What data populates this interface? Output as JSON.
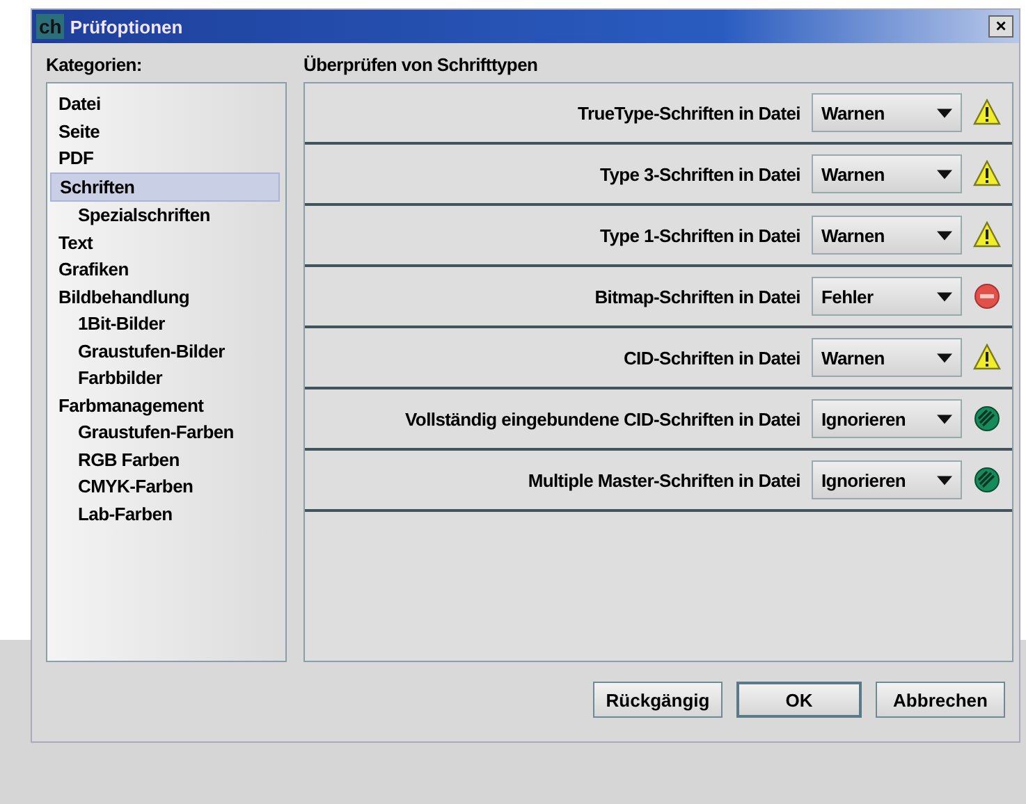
{
  "window": {
    "title": "Prüfoptionen",
    "logo": "ch",
    "close": "×"
  },
  "sidebar": {
    "heading": "Kategorien:",
    "items": [
      {
        "label": "Datei",
        "selected": false
      },
      {
        "label": "Seite",
        "selected": false
      },
      {
        "label": "PDF",
        "selected": false
      },
      {
        "label": "Schriften",
        "selected": true,
        "children": [
          {
            "label": "Spezialschriften",
            "selected": false
          }
        ]
      },
      {
        "label": "Text",
        "selected": false
      },
      {
        "label": "Grafiken",
        "selected": false
      },
      {
        "label": "Bildbehandlung",
        "selected": false,
        "children": [
          {
            "label": "1Bit-Bilder",
            "selected": false
          },
          {
            "label": "Graustufen-Bilder",
            "selected": false
          },
          {
            "label": "Farbbilder",
            "selected": false
          }
        ]
      },
      {
        "label": "Farbmanagement",
        "selected": false,
        "children": [
          {
            "label": "Graustufen-Farben",
            "selected": false
          },
          {
            "label": "RGB Farben",
            "selected": false
          },
          {
            "label": "CMYK-Farben",
            "selected": false
          },
          {
            "label": "Lab-Farben",
            "selected": false
          }
        ]
      }
    ]
  },
  "panel": {
    "heading": "Überprüfen von Schrifttypen",
    "rows": [
      {
        "label": "TrueType-Schriften in Datei",
        "value": "Warnen",
        "kind": "warning"
      },
      {
        "label": "Type 3-Schriften in Datei",
        "value": "Warnen",
        "kind": "warning"
      },
      {
        "label": "Type 1-Schriften in Datei",
        "value": "Warnen",
        "kind": "warning"
      },
      {
        "label": "Bitmap-Schriften in Datei",
        "value": "Fehler",
        "kind": "error"
      },
      {
        "label": "CID-Schriften in Datei",
        "value": "Warnen",
        "kind": "warning"
      },
      {
        "label": "Vollständig eingebundene CID-Schriften in Datei",
        "value": "Ignorieren",
        "kind": "ignore"
      },
      {
        "label": "Multiple Master-Schriften in Datei",
        "value": "Ignorieren",
        "kind": "ignore"
      }
    ]
  },
  "buttons": [
    {
      "label": "Rückgängig",
      "default": false
    },
    {
      "label": "OK",
      "default": true
    },
    {
      "label": "Abbrechen",
      "default": false
    }
  ]
}
